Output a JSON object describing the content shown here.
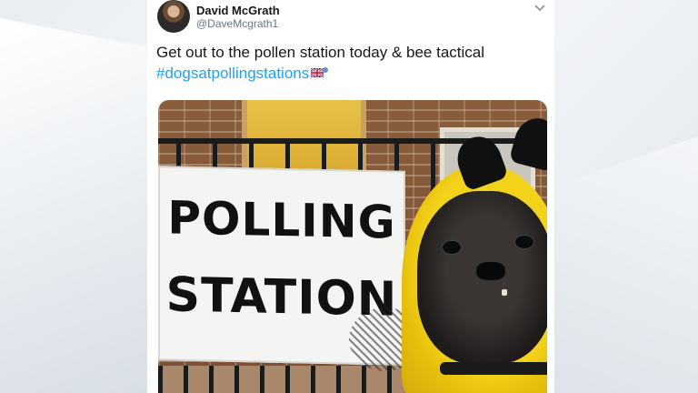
{
  "tweet": {
    "author_name": "David McGrath",
    "author_handle": "@DaveMcgrath1",
    "text": "Get out to the pollen station today & bee tactical",
    "hashtag": "#dogsatpollingstations",
    "icons": {
      "avatar": "avatar",
      "menu": "chevron-down-icon",
      "flag": "union-jack-bee-emoji-icon"
    }
  },
  "photo": {
    "sign_line_1": "POLLING",
    "sign_line_2": "STATION"
  },
  "colors": {
    "hashtag": "#1da1f2",
    "card_bg": "#ffffff",
    "dog_costume": "#f3d21b"
  }
}
